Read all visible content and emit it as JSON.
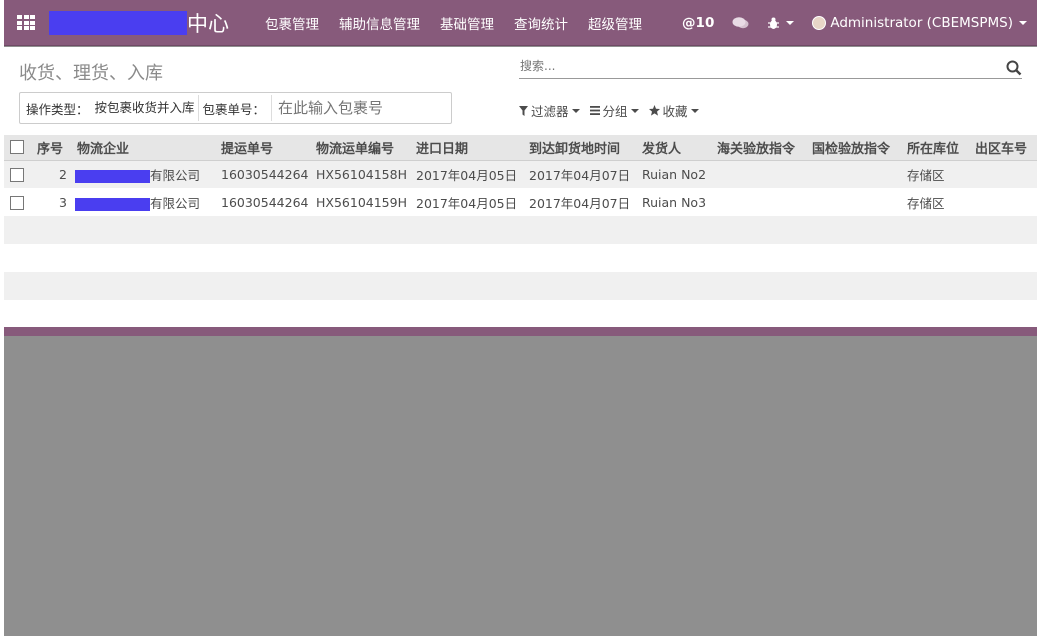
{
  "brand": {
    "suffix": "中心"
  },
  "menu": [
    {
      "label": "包裹管理"
    },
    {
      "label": "辅助信息管理"
    },
    {
      "label": "基础管理"
    },
    {
      "label": "查询统计"
    },
    {
      "label": "超级管理"
    }
  ],
  "right_nav": {
    "mentions_label": "@10",
    "user": "Administrator (CBEMSPMS)"
  },
  "breadcrumb": "收货、理货、入库",
  "search": {
    "placeholder": "搜索..."
  },
  "filters": {
    "op_type_label": "操作类型：",
    "op_type_value": "按包裹收货并入库",
    "package_label": "包裹单号：",
    "package_placeholder": "在此输入包裹号"
  },
  "search_options": {
    "filter": "过滤器",
    "group": "分组",
    "favorite": "收藏"
  },
  "table": {
    "columns": [
      "序号",
      "物流企业",
      "提运单号",
      "物流运单编号",
      "进口日期",
      "到达卸货地时间",
      "发货人",
      "海关验放指令",
      "国检验放指令",
      "所在库位",
      "出区车号"
    ],
    "rows": [
      {
        "seq": "2",
        "company_suffix": "有限公司",
        "bill": "16030544264",
        "waybill": "HX56104158H",
        "import_date": "2017年04月05日",
        "arrive": "2017年04月07日",
        "shipper": "Ruian No2",
        "customs": "",
        "inspection": "",
        "location": "存储区",
        "car": ""
      },
      {
        "seq": "3",
        "company_suffix": "有限公司",
        "bill": "16030544264",
        "waybill": "HX56104159H",
        "import_date": "2017年04月05日",
        "arrive": "2017年04月07日",
        "shipper": "Ruian No3",
        "customs": "",
        "inspection": "",
        "location": "存储区",
        "car": ""
      }
    ]
  },
  "colors": {
    "brand": "#875a7b",
    "redaction": "#4a3ef0"
  }
}
